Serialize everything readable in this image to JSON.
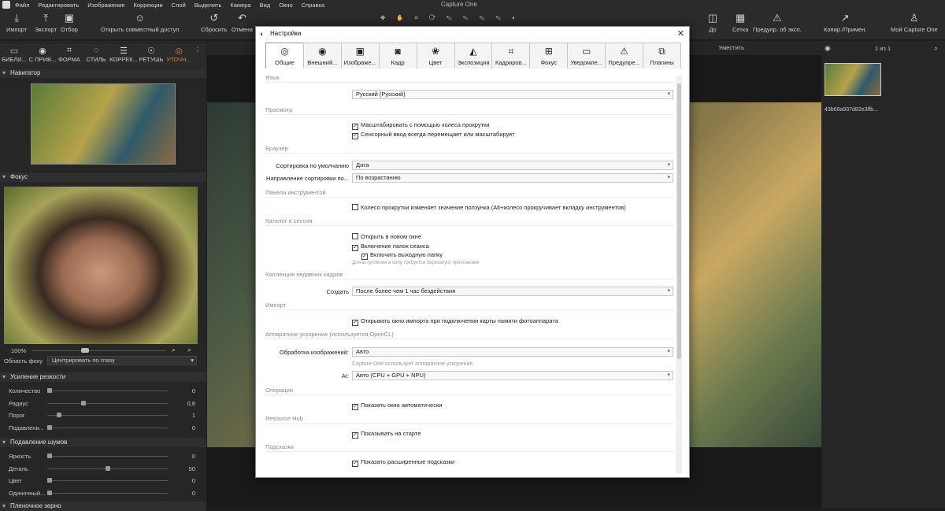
{
  "app_title": "Capture One",
  "menu": [
    "Файл",
    "Редактировать",
    "Изображение",
    "Коррекции",
    "Слой",
    "Выделить",
    "Камера",
    "Вид",
    "Окно",
    "Справка"
  ],
  "toolbar": {
    "import": "Импорт",
    "export": "Экспорт",
    "select": "Отбор",
    "open_shared": "Открыть совместный доступ",
    "reset": "Сбросить",
    "undo": "Отмена",
    "after": "До",
    "grid": "Сетка",
    "exposure_warn": "Предупр. об эксп.",
    "copy_apply": "Копир./Примен.",
    "my_capture_one": "Мой Capture One"
  },
  "tool_tabs": [
    "БИБЛИ...",
    "С ПРИВ...",
    "ФОРМА",
    "СТИЛЬ",
    "КОРРЕК...",
    "РЕТУШЬ",
    "УТОЧН..."
  ],
  "left": {
    "navigator": "Навигатор",
    "focus": "Фокус",
    "zoom": "100%",
    "focus_area_label": "Область фоку",
    "focus_area_value": "Центрировать по глазу",
    "sharpening": "Усиление резкости",
    "sharp_rows": [
      {
        "label": "Количество",
        "value": "0",
        "level": 0
      },
      {
        "label": "Радиус",
        "value": "0,8",
        "level": 0.3
      },
      {
        "label": "Порог",
        "value": "1",
        "level": 0.1
      },
      {
        "label": "Подавлени...",
        "value": "0",
        "level": 0
      }
    ],
    "noise": "Подавление шумов",
    "noise_rows": [
      {
        "label": "Яркость",
        "value": "0",
        "level": 0
      },
      {
        "label": "Деталь",
        "value": "50",
        "level": 0.5
      },
      {
        "label": "Цвет",
        "value": "0",
        "level": 0
      },
      {
        "label": "Одиночный...",
        "value": "0",
        "level": 0
      }
    ],
    "grain": "Пленочное зерно"
  },
  "center": {
    "fit": "Уместить"
  },
  "right": {
    "count": "1 из 1",
    "filename": "43b68a937d82e3ffb..."
  },
  "dialog": {
    "title": "Настройки",
    "tabs": [
      {
        "label": "Общие",
        "icon": "general-icon"
      },
      {
        "label": "Внешний...",
        "icon": "eye-icon"
      },
      {
        "label": "Изображе...",
        "icon": "image-icon"
      },
      {
        "label": "Кадр",
        "icon": "camera-icon"
      },
      {
        "label": "Цвет",
        "icon": "color-icon"
      },
      {
        "label": "Экспозиция",
        "icon": "exposure-icon"
      },
      {
        "label": "Кадриров...",
        "icon": "crop-icon"
      },
      {
        "label": "Фокус",
        "icon": "focus-icon"
      },
      {
        "label": "Уведомле...",
        "icon": "message-icon"
      },
      {
        "label": "Предупре...",
        "icon": "warning-icon"
      },
      {
        "label": "Плагины",
        "icon": "plugin-icon"
      }
    ],
    "language_group": "Язык",
    "language": "Русский (Русский)",
    "view_group": "Просмотр",
    "view_cb1": "Масштабировать с помощью колеса прокрутки",
    "view_cb2": "Сенсорный ввод всегда перемещает или масштабирует",
    "browser_group": "Браузер",
    "sort_default_label": "Сортировка по умолчанию",
    "sort_default": "Дата",
    "sort_dir_label": "Направление сортировки по...",
    "sort_dir": "По возрастанию",
    "tool_panels_group": "Панели инструментов",
    "tool_cb": "Колесо прокрутки изменяет значение ползунка (Alt+колесо прокручивает вкладку инструментов)",
    "catalog_group": "Каталог и сессия",
    "cat_cb1": "Открыть в новом окне",
    "cat_cb2": "Включение папок сеанса",
    "cat_cb3": "Включить выходную папку",
    "cat_note": "Для вступления в силу требуется перезапуск приложения",
    "recent_group": "Коллекция недавних кадров",
    "create_label": "Создать",
    "create": "После более чем 1 час бездействия",
    "import_group": "Импорт",
    "import_cb": "Открывать окно импорта при подключении карты памяти фотоаппарата",
    "hw_group": "Аппаратное ускорение (используется OpenCL)",
    "proc_label": "Обработка изображений:",
    "proc": "Авто",
    "hw_note": "Capture One использует аппаратное ускорение.",
    "ai_label": "AI:",
    "ai": "Авто (CPU + GPU + NPU)",
    "ops_group": "Операции",
    "ops_cb": "Показать окно автоматически",
    "hub_group": "Resource Hub",
    "hub_cb": "Показывать на старте",
    "hints_group": "Подсказки",
    "hints_cb": "Показать расширенные подсказки"
  }
}
